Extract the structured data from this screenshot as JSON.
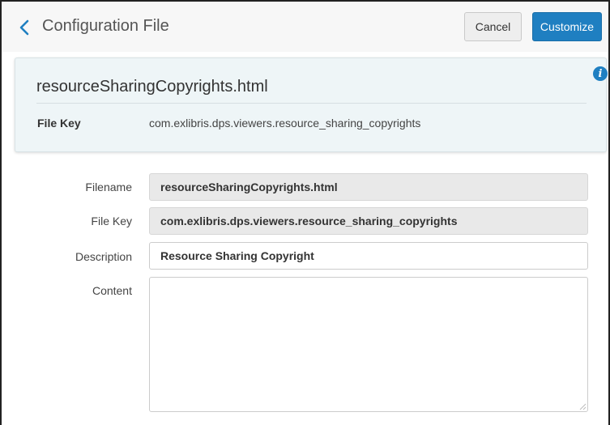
{
  "header": {
    "title": "Configuration File",
    "cancel_label": "Cancel",
    "customize_label": "Customize",
    "accent_color": "#1f7fc1"
  },
  "card": {
    "title": "resourceSharingCopyrights.html",
    "file_key_label": "File Key",
    "file_key_value": "com.exlibris.dps.viewers.resource_sharing_copyrights",
    "info_icon": "info-icon"
  },
  "form": {
    "filename": {
      "label": "Filename",
      "value": "resourceSharingCopyrights.html"
    },
    "file_key": {
      "label": "File Key",
      "value": "com.exlibris.dps.viewers.resource_sharing_copyrights"
    },
    "description": {
      "label": "Description",
      "value": "Resource Sharing Copyright"
    },
    "content": {
      "label": "Content",
      "value": ""
    }
  }
}
